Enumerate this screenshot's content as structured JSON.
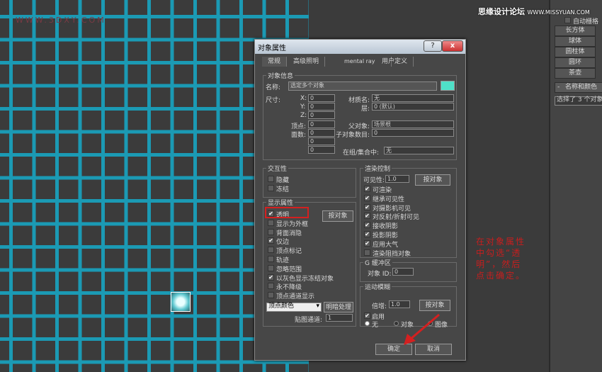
{
  "viewport": {
    "watermark": "WWW.3DXY.COM",
    "grid_color": "#1b9ab4"
  },
  "watermark": {
    "site": "思缘设计论坛",
    "url": "WWW.MISSYUAN.COM"
  },
  "right_panel": {
    "autogrid": "自动栅格",
    "buttons": [
      "长方体",
      "球体",
      "圆柱体",
      "圆环",
      "茶壶"
    ],
    "rollout": "名称和颜色",
    "rollout_toggle": "-",
    "selection": "选择了 3 个对象"
  },
  "annotation": "在对象属性中勾选“透明”，然后点击确定。",
  "dialog": {
    "title": "对象属性",
    "help": "?",
    "close": "x",
    "tabs": [
      "常规",
      "高级照明",
      "mental ray",
      "用户定义"
    ],
    "info": {
      "group": "对象信息",
      "name_label": "名称:",
      "name_value": "选定多个对象",
      "color": "#4fe0c8",
      "dims_label": "尺寸:",
      "x": "X:",
      "y": "Y:",
      "z": "Z:",
      "xv": "0",
      "yv": "0",
      "zv": "0",
      "verts_label": "顶点:",
      "verts": "0",
      "faces_label": "面数:",
      "faces": "0",
      "extra1": "0",
      "extra2": "0",
      "material_label": "材质名:",
      "material": "无",
      "layer_label": "层:",
      "layer": "0 (默认)",
      "parent_label": "父对象:",
      "parent": "场景根",
      "children_label": "子对象数目:",
      "children": "0",
      "group_label": "在组/集合中:",
      "group_value": "无"
    },
    "interactivity": {
      "group": "交互性",
      "hide": "隐藏",
      "freeze": "冻结"
    },
    "display": {
      "group": "显示属性",
      "by_object": "按对象",
      "items": [
        {
          "label": "透明",
          "checked": true
        },
        {
          "label": "显示为外框",
          "checked": false
        },
        {
          "label": "背面消隐",
          "checked": false
        },
        {
          "label": "仅边",
          "checked": true
        },
        {
          "label": "顶点标记",
          "checked": false
        },
        {
          "label": "轨迹",
          "checked": false
        },
        {
          "label": "忽略范围",
          "checked": false
        },
        {
          "label": "以灰色显示冻结对象",
          "checked": true
        },
        {
          "label": "永不降级",
          "checked": false
        },
        {
          "label": "顶点通道显示",
          "checked": false
        }
      ],
      "vertex_select": "顶点颜色",
      "shaded": "明暗处理",
      "map_channel_label": "贴图通道:",
      "map_channel": "1"
    },
    "render": {
      "group": "渲染控制",
      "visibility_label": "可见性:",
      "visibility": "1.0",
      "by_object": "按对象",
      "items": [
        {
          "label": "可渲染",
          "checked": true
        },
        {
          "label": "继承可见性",
          "checked": true
        },
        {
          "label": "对摄影机可见",
          "checked": true
        },
        {
          "label": "对反射/折射可见",
          "checked": true
        },
        {
          "label": "接收阴影",
          "checked": true
        },
        {
          "label": "投影阴影",
          "checked": true
        },
        {
          "label": "应用大气",
          "checked": true
        },
        {
          "label": "渲染阻挡对象",
          "checked": false
        }
      ]
    },
    "gbuffer": {
      "group": "G 缓冲区",
      "id_label": "对象 ID:",
      "id": "0"
    },
    "motion_blur": {
      "group": "运动模糊",
      "mult_label": "倍增:",
      "mult": "1.0",
      "by_object": "按对象",
      "enabled_label": "启用",
      "enabled": true,
      "options": [
        "无",
        "对象",
        "图像"
      ],
      "selected": "无"
    },
    "ok": "确定",
    "cancel": "取消"
  }
}
